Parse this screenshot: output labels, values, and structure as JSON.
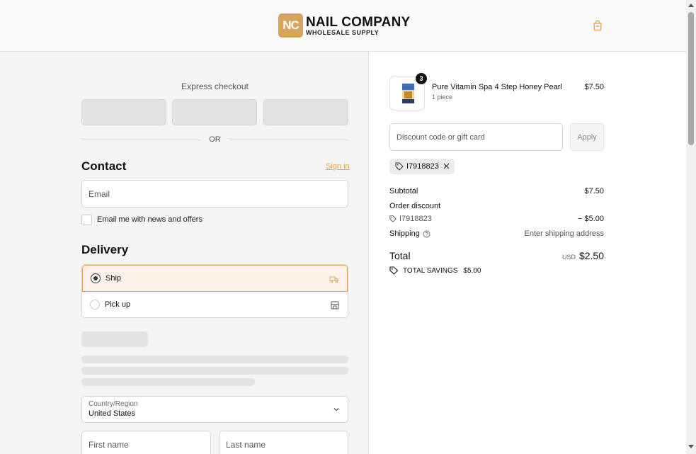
{
  "brand": {
    "mark": "NC",
    "name": "NAIL COMPANY",
    "tagline": "WHOLESALE SUPPLY",
    "accent": "#d4a55a"
  },
  "header": {
    "cart_icon": "shopping-bag-icon"
  },
  "express": {
    "label": "Express checkout",
    "divider": "OR"
  },
  "contact": {
    "title": "Contact",
    "sign_in": "Sign in",
    "email_placeholder": "Email",
    "newsletter_label": "Email me with news and offers",
    "newsletter_checked": false
  },
  "delivery": {
    "title": "Delivery",
    "options": [
      {
        "label": "Ship",
        "selected": true,
        "icon": "truck-icon"
      },
      {
        "label": "Pick up",
        "selected": false,
        "icon": "store-icon"
      }
    ],
    "country_label": "Country/Region",
    "country_value": "United States",
    "first_name_placeholder": "First name",
    "last_name_placeholder": "Last name"
  },
  "summary": {
    "product": {
      "name": "Pure Vitamin Spa 4 Step Honey Pearl",
      "variant": "1 piece",
      "price": "$7.50",
      "quantity": "3"
    },
    "discount_placeholder": "Discount code or gift card",
    "apply_label": "Apply",
    "applied_code": "I7918823",
    "subtotal_label": "Subtotal",
    "subtotal_value": "$7.50",
    "order_discount_label": "Order discount",
    "discount_code": "I7918823",
    "discount_value": "− $5.00",
    "shipping_label": "Shipping",
    "shipping_value": "Enter shipping address",
    "total_label": "Total",
    "currency": "USD",
    "total_value": "$2.50",
    "savings_label": "TOTAL SAVINGS",
    "savings_value": "$5.00"
  }
}
